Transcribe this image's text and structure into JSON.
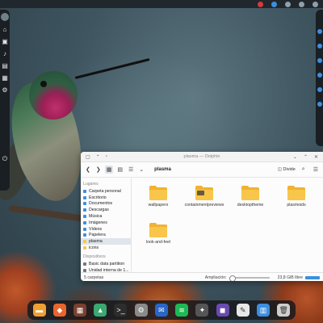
{
  "window": {
    "title": "plasma — Dolphin",
    "split_label": "Divide",
    "breadcrumb": "plasma"
  },
  "sidebar": {
    "places_heading": "Lugares",
    "places": [
      {
        "label": "Carpeta personal",
        "selected": false
      },
      {
        "label": "Escritorio",
        "selected": false
      },
      {
        "label": "Documentos",
        "selected": false
      },
      {
        "label": "Descargas",
        "selected": false
      },
      {
        "label": "Música",
        "selected": false
      },
      {
        "label": "Imágenes",
        "selected": false
      },
      {
        "label": "Vídeos",
        "selected": false
      },
      {
        "label": "Papelera",
        "selected": false
      },
      {
        "label": "plasma",
        "selected": true
      },
      {
        "label": "icons",
        "selected": false
      }
    ],
    "devices_heading": "Dispositivos",
    "devices": [
      {
        "label": "Basic data partition"
      },
      {
        "label": "Unidad interna de 1..."
      }
    ]
  },
  "files": [
    {
      "name": "wallpapers"
    },
    {
      "name": "containmentpreviews"
    },
    {
      "name": "desktoptheme"
    },
    {
      "name": "plasmoids"
    },
    {
      "name": "look-and-feel"
    }
  ],
  "status": {
    "count": "5 carpetas",
    "zoom_label": "Ampliación:",
    "free_space": "23,8 GiB libre"
  },
  "colors": {
    "accent": "#3d8ee0",
    "folder": "#f7c64a",
    "panel": "#1a1f24"
  },
  "dock": [
    {
      "icon": "file-manager-icon",
      "color": "#f0a030"
    },
    {
      "icon": "firefox-icon",
      "color": "#e8652c"
    },
    {
      "icon": "app-grid-icon",
      "color": "#7a4030"
    },
    {
      "icon": "image-viewer-icon",
      "color": "#3aa870"
    },
    {
      "icon": "terminal-icon",
      "color": "#2d2d2d"
    },
    {
      "icon": "settings-icon",
      "color": "#8a8a8a"
    },
    {
      "icon": "mail-icon",
      "color": "#2a66c8"
    },
    {
      "icon": "spotify-icon",
      "color": "#1db954"
    },
    {
      "icon": "inkscape-icon",
      "color": "#555555"
    },
    {
      "icon": "discover-icon",
      "color": "#6a4ab0"
    },
    {
      "icon": "text-editor-icon",
      "color": "#e8e8e8"
    },
    {
      "icon": "calculator-icon",
      "color": "#3d8ee0"
    },
    {
      "icon": "trash-icon",
      "color": "#cfcfcf"
    }
  ]
}
